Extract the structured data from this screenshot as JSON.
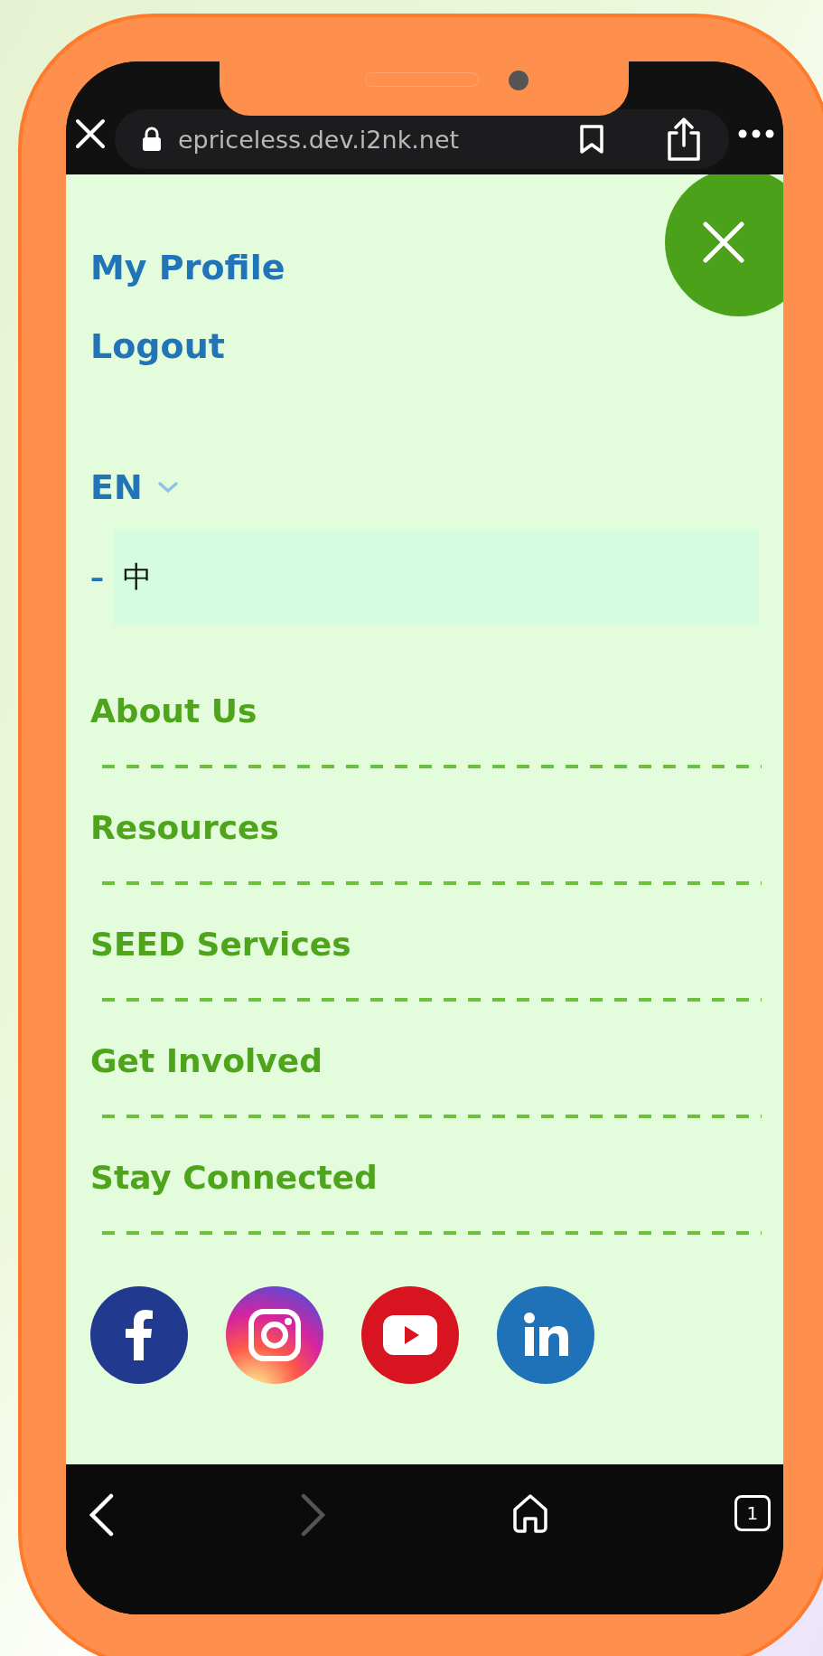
{
  "browser": {
    "url": "epriceless.dev.i2nk.net",
    "tab_count": "1",
    "forward_disabled": true
  },
  "account_links": [
    {
      "label": "My Profile"
    },
    {
      "label": "Logout"
    }
  ],
  "language": {
    "current": "EN",
    "expanded": true,
    "options": [
      {
        "bullet": "–",
        "label": "中",
        "highlighted": true
      }
    ]
  },
  "nav_items": [
    {
      "label": "About Us"
    },
    {
      "label": "Resources"
    },
    {
      "label": "SEED Services"
    },
    {
      "label": "Get Involved"
    },
    {
      "label": "Stay Connected"
    }
  ],
  "social_links": [
    {
      "kind": "facebook"
    },
    {
      "kind": "instagram"
    },
    {
      "kind": "youtube"
    },
    {
      "kind": "linkedin"
    }
  ]
}
